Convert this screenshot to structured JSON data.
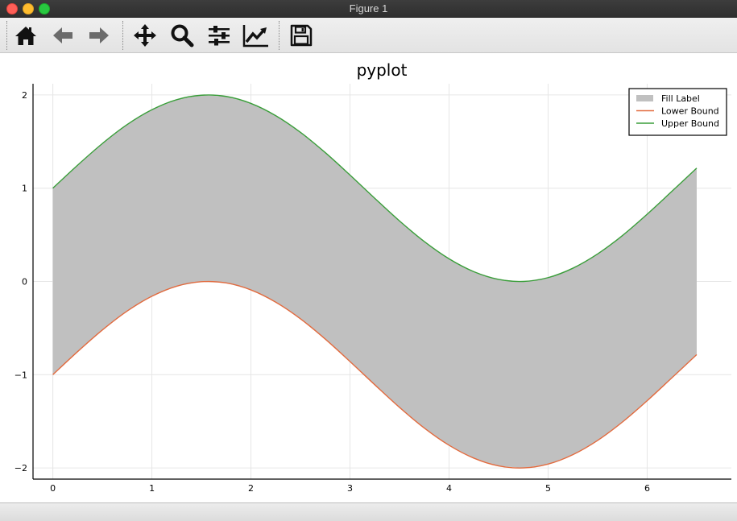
{
  "window": {
    "title": "Figure 1"
  },
  "toolbar": {
    "buttons": [
      {
        "name": "home",
        "icon": "home-icon"
      },
      {
        "name": "back",
        "icon": "arrow-left-icon"
      },
      {
        "name": "forward",
        "icon": "arrow-right-icon"
      },
      {
        "name": "pan",
        "icon": "move-icon"
      },
      {
        "name": "zoom",
        "icon": "magnifier-icon"
      },
      {
        "name": "subplots",
        "icon": "sliders-icon"
      },
      {
        "name": "customize",
        "icon": "chart-line-icon"
      },
      {
        "name": "save",
        "icon": "floppy-disk-icon"
      }
    ]
  },
  "chart_data": {
    "type": "line",
    "title": "pyplot",
    "xlabel": "",
    "ylabel": "",
    "xlim": [
      -0.2,
      6.85
    ],
    "ylim": [
      -2.12,
      2.12
    ],
    "xticks": [
      0,
      1,
      2,
      3,
      4,
      5,
      6
    ],
    "yticks": [
      -2,
      -1,
      0,
      1,
      2
    ],
    "grid": true,
    "legend_position": "top-right",
    "x": [
      0,
      0.25,
      0.5,
      0.75,
      1.0,
      1.25,
      1.5,
      1.75,
      2.0,
      2.25,
      2.5,
      2.75,
      3.0,
      3.25,
      3.5,
      3.75,
      4.0,
      4.25,
      4.5,
      4.75,
      5.0,
      5.25,
      5.5,
      5.75,
      6.0,
      6.25,
      6.5
    ],
    "series": [
      {
        "name": "Lower Bound",
        "color": "#e26b3f",
        "values": [
          -1.0,
          -0.753,
          -0.521,
          -0.318,
          -0.159,
          -0.051,
          -0.003,
          -0.016,
          -0.091,
          -0.222,
          -0.401,
          -0.618,
          -0.859,
          -1.108,
          -1.351,
          -1.572,
          -1.757,
          -1.895,
          -1.978,
          -2.0,
          -1.959,
          -1.858,
          -1.705,
          -1.508,
          -1.279,
          -1.033,
          -0.785
        ]
      },
      {
        "name": "Upper Bound",
        "color": "#3a9e3a",
        "values": [
          1.0,
          1.247,
          1.479,
          1.682,
          1.841,
          1.949,
          1.997,
          1.984,
          1.909,
          1.778,
          1.599,
          1.382,
          1.141,
          0.892,
          0.649,
          0.428,
          0.243,
          0.105,
          0.022,
          0.0,
          0.041,
          0.142,
          0.295,
          0.492,
          0.721,
          0.967,
          1.215
        ]
      }
    ],
    "fill": {
      "name": "Fill Label",
      "color": "#c0c0c0",
      "between": [
        "Lower Bound",
        "Upper Bound"
      ]
    }
  }
}
